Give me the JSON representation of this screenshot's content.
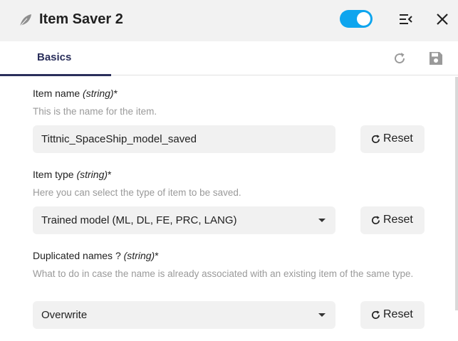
{
  "header": {
    "title": "Item Saver 2",
    "toggle_on": true,
    "accent_color": "#0ea5ee"
  },
  "tabs": [
    {
      "label": "Basics",
      "active": true
    }
  ],
  "fields": [
    {
      "label": "Item name ",
      "type": "(string)",
      "required_mark": "*",
      "help": "This is the name for the item.",
      "value": "Tittnic_SpaceShip_model_saved",
      "control": "text"
    },
    {
      "label": "Item type ",
      "type": "(string)",
      "required_mark": "*",
      "help": "Here you can select the type of item to be saved.",
      "value": "Trained model (ML, DL, FE, PRC, LANG)",
      "control": "select"
    },
    {
      "label": "Duplicated names ? ",
      "type": "(string)",
      "required_mark": "*",
      "help": "What to do in case the name is already associated with an existing item of the same type.",
      "value": "Overwrite",
      "control": "select"
    }
  ],
  "reset_label": "Reset",
  "icons": {
    "app": "feather-icon",
    "menu": "collapse-menu-icon",
    "close": "close-icon",
    "refresh": "refresh-icon",
    "save": "save-icon",
    "reset": "reset-icon"
  }
}
